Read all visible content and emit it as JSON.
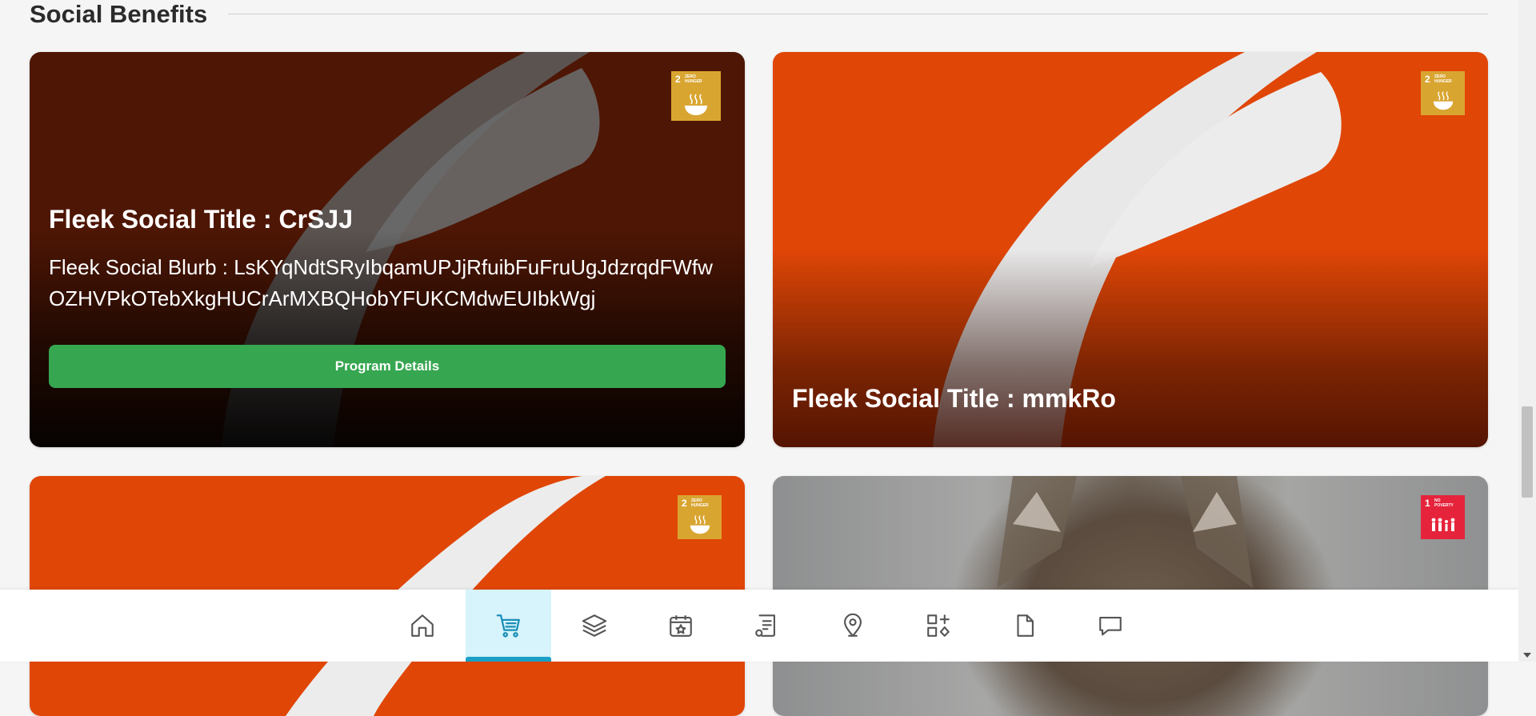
{
  "section": {
    "title": "Social Benefits"
  },
  "cards": [
    {
      "title": "Fleek Social Title : CrSJJ",
      "blurb": "Fleek Social Blurb : LsKYqNdtSRyIbqamUPJjRfuibFuFruUgJdzrqdFWfwOZHVPkOTebXkgHUCrArMXBQHobYFUKCMdwEUIbkWgj",
      "button_label": "Program Details",
      "sdg": {
        "number": "2",
        "label": "ZERO HUNGER",
        "color": "#d9a531"
      }
    },
    {
      "title": "Fleek Social Title : mmkRo",
      "sdg": {
        "number": "2",
        "label": "ZERO HUNGER",
        "color": "#d9a531"
      }
    },
    {
      "sdg": {
        "number": "2",
        "label": "ZERO HUNGER",
        "color": "#d9a531"
      }
    },
    {
      "sdg": {
        "number": "1",
        "label": "NO POVERTY",
        "color": "#e5243b"
      }
    }
  ],
  "colors": {
    "accent_green": "#36a650",
    "brand_orange": "#e04606",
    "nav_active_bg": "#d7f3fb",
    "nav_active_bar": "#1a9fc6"
  },
  "nav": {
    "items": [
      {
        "icon": "home-icon"
      },
      {
        "icon": "cart-icon",
        "active": true
      },
      {
        "icon": "layers-icon"
      },
      {
        "icon": "calendar-star-icon"
      },
      {
        "icon": "document-list-icon"
      },
      {
        "icon": "map-pin-icon"
      },
      {
        "icon": "apps-add-icon"
      },
      {
        "icon": "file-icon"
      },
      {
        "icon": "chat-icon"
      }
    ]
  }
}
